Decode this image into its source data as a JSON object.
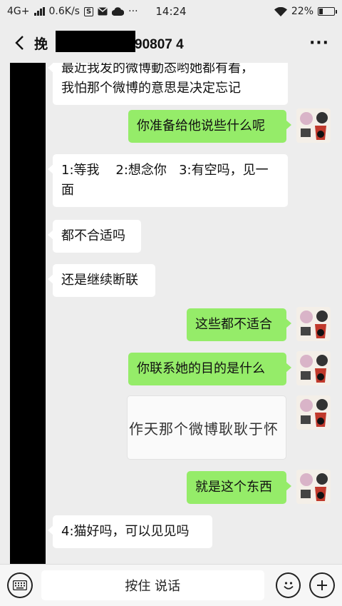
{
  "status_bar": {
    "network": "4G+",
    "speed": "0.6K/s",
    "s_badge": "S",
    "time": "14:24",
    "battery": "22%"
  },
  "header": {
    "title_prefix": "挽",
    "title_suffix": "90807 4",
    "more": "···"
  },
  "messages": [
    {
      "side": "left",
      "lines": [
        "最近我发的微博動态哟她都有看，",
        "我怕那个微博的意思是决定忘记"
      ]
    },
    {
      "side": "right",
      "text": "你准备给他说些什么呢"
    },
    {
      "side": "left",
      "lines": [
        "1:等我    2:想念你   3:有空吗，见一",
        "面"
      ]
    },
    {
      "side": "left",
      "text": "都不合适吗"
    },
    {
      "side": "left",
      "text": "还是继续断联"
    },
    {
      "side": "right",
      "text": "这些都不适合"
    },
    {
      "side": "right",
      "text": "你联系她的目的是什么"
    },
    {
      "side": "right",
      "image_text": "作天那个微博耿耿于怀"
    },
    {
      "side": "right",
      "text": "就是这个东西"
    },
    {
      "side": "left",
      "text": "4:猫好吗，可以见见吗"
    }
  ],
  "input_bar": {
    "hold_to_talk": "按住 说话",
    "keyboard_icon": "keyboard-icon",
    "emoji_icon": "emoji-icon",
    "plus_icon": "plus-icon"
  },
  "colors": {
    "background": "#ededed",
    "bubble_right": "#95ec69",
    "bubble_left": "#ffffff"
  }
}
